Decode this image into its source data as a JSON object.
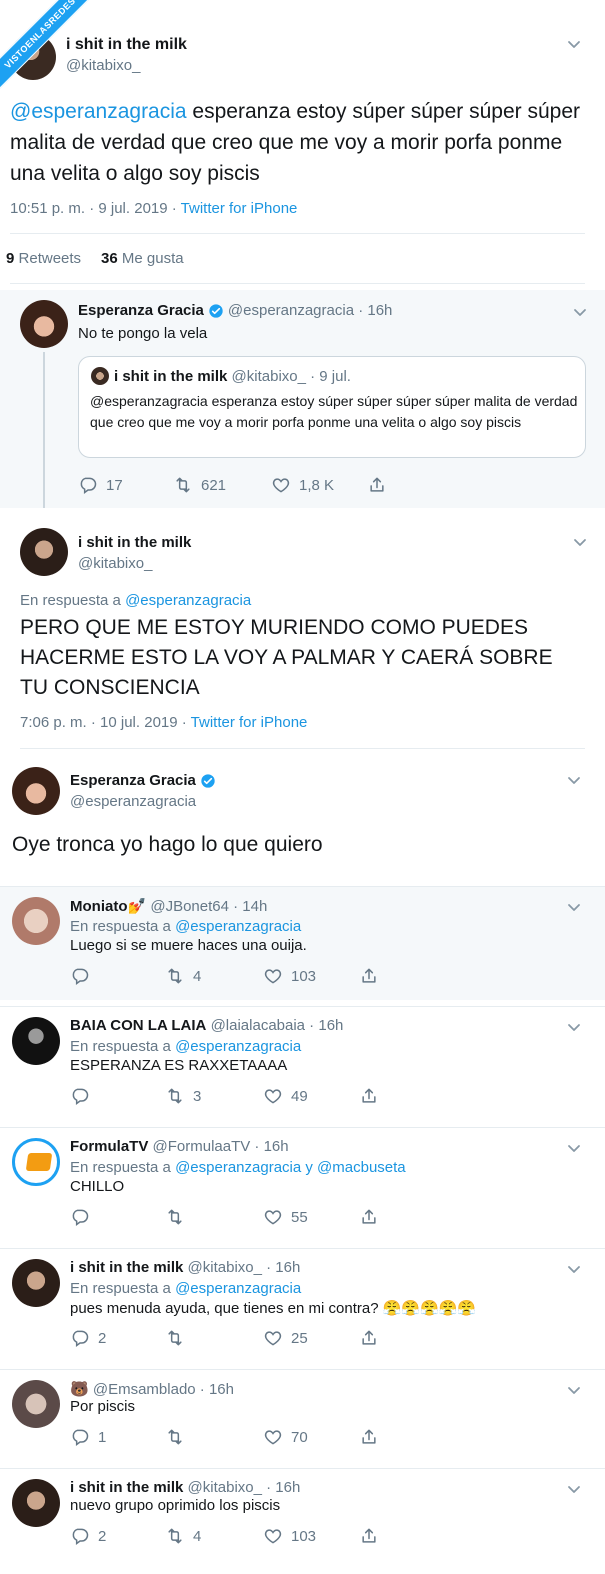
{
  "watermark": "VISTOENLASREDES",
  "main_tweet": {
    "name": "i shit in the milk",
    "handle": "@kitabixo_",
    "mention": "@esperanzagracia",
    "text": " esperanza estoy súper súper súper súper malita de verdad que creo que me voy a morir porfa ponme una velita o algo soy piscis",
    "time": "10:51 p. m. · 9 jul. 2019 · ",
    "source": "Twitter for iPhone",
    "retweets_count": "9",
    "retweets_label": "Retweets",
    "likes_count": "36",
    "likes_label": "Me gusta"
  },
  "reply_esperanza": {
    "name": "Esperanza Gracia",
    "handle": "@esperanzagracia · 16h",
    "text": "No te pongo la vela",
    "quote": {
      "name": "i shit in the milk",
      "handle": "@kitabixo_ · 9 jul.",
      "text": "@esperanzagracia esperanza estoy súper súper súper súper malita de verdad que creo que me voy a morir porfa ponme una velita o algo soy piscis"
    },
    "replies": "17",
    "retweets": "621",
    "likes": "1,8 K"
  },
  "tweet2": {
    "name": "i shit in the milk",
    "handle": "@kitabixo_",
    "in_reply_prefix": "En respuesta a ",
    "in_reply_to": "@esperanzagracia",
    "text": "PERO QUE ME ESTOY MURIENDO COMO PUEDES HACERME ESTO LA VOY A PALMAR Y CAERÁ SOBRE TU CONSCIENCIA",
    "time": "7:06 p. m. · 10 jul. 2019 · ",
    "source": "Twitter for iPhone"
  },
  "tweet3": {
    "name": "Esperanza Gracia",
    "handle": "@esperanzagracia",
    "text": "Oye tronca yo hago lo que quiero"
  },
  "replies": [
    {
      "name": "Moniato💅",
      "handle": "@JBonet64 · 14h",
      "prefix": "En respuesta a ",
      "to": "@esperanzagracia",
      "text": "Luego si se muere haces una ouija.",
      "replies": "",
      "retweets": "4",
      "likes": "103"
    },
    {
      "name": "BAIA CON LA LAIA",
      "handle": "@laialacabaia · 16h",
      "prefix": "En respuesta a ",
      "to": "@esperanzagracia",
      "text": "ESPERANZA ES RAXXETAAAA",
      "replies": "",
      "retweets": "3",
      "likes": "49"
    },
    {
      "name": "FormulaTV",
      "handle": "@FormulaaTV · 16h",
      "prefix": "En respuesta a ",
      "to": "@esperanzagracia y @macbuseta",
      "text": "CHILLO",
      "replies": "",
      "retweets": "",
      "likes": "55"
    },
    {
      "name": "i shit in the milk",
      "handle": "@kitabixo_ · 16h",
      "prefix": "En respuesta a ",
      "to": "@esperanzagracia",
      "text": "pues menuda ayuda, que tienes en mi contra? 😤😤😤😤😤",
      "replies": "2",
      "retweets": "",
      "likes": "25"
    },
    {
      "name": "🐻",
      "handle": "@Emsamblado · 16h",
      "prefix": "",
      "to": "",
      "text": "Por piscis",
      "replies": "1",
      "retweets": "",
      "likes": "70"
    },
    {
      "name": "i shit in the milk",
      "handle": "@kitabixo_ · 16h",
      "prefix": "",
      "to": "",
      "text": "nuevo grupo oprimido los piscis",
      "replies": "2",
      "retweets": "4",
      "likes": "103"
    }
  ]
}
